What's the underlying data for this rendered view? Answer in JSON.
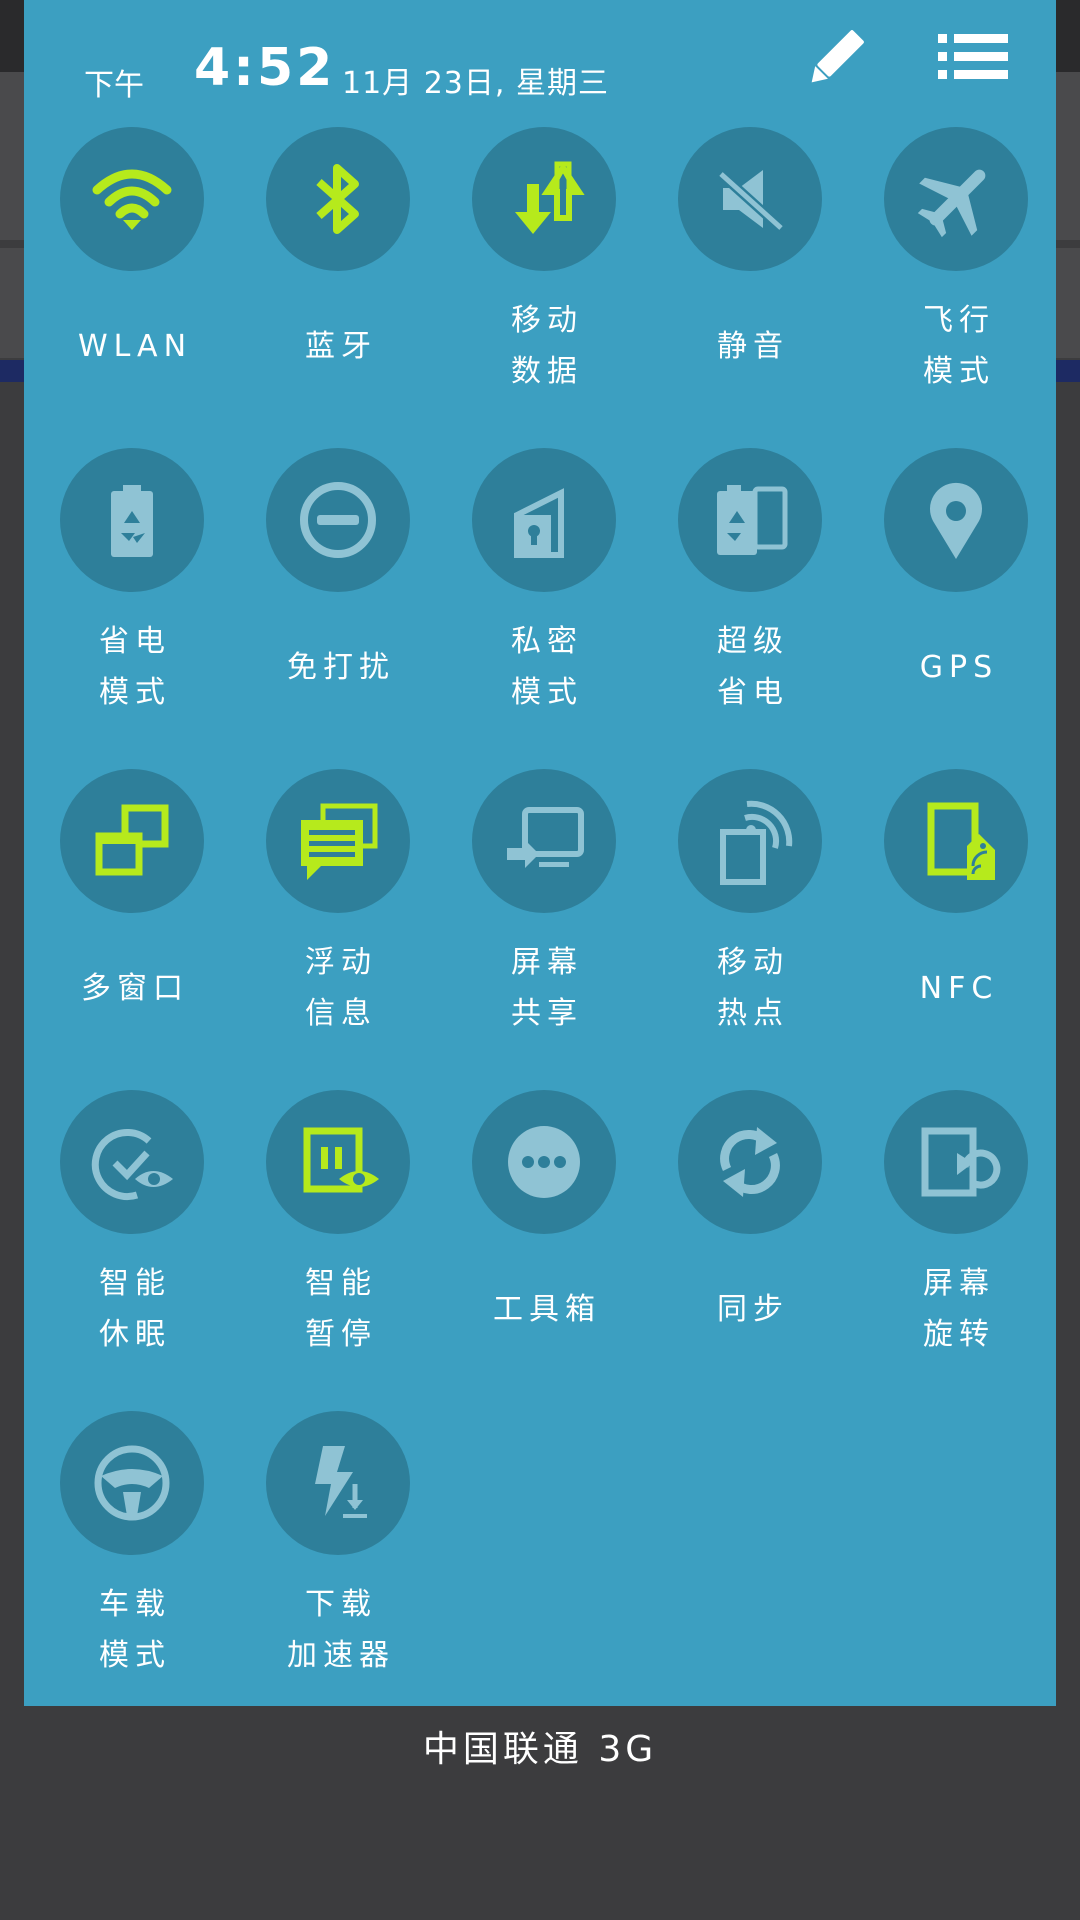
{
  "header": {
    "ampm": "下午",
    "time": "4:52",
    "date": "11月 23日, 星期三",
    "edit_icon": "pencil-icon",
    "list_icon": "list-icon"
  },
  "colors": {
    "active": "#b6ea1c",
    "inactive": "#8fc3d4",
    "panel": "#3c9fc1",
    "circle": "#2e7f9a"
  },
  "tiles": [
    {
      "line1": "WLAN",
      "line2": "",
      "icon": "wifi-icon",
      "active": true
    },
    {
      "line1": "蓝牙",
      "line2": "",
      "icon": "bluetooth-icon",
      "active": true
    },
    {
      "line1": "移动",
      "line2": "数据",
      "icon": "mobile-data-icon",
      "active": true
    },
    {
      "line1": "静音",
      "line2": "",
      "icon": "mute-icon",
      "active": false
    },
    {
      "line1": "飞行",
      "line2": "模式",
      "icon": "airplane-icon",
      "active": false
    },
    {
      "line1": "省电",
      "line2": "模式",
      "icon": "battery-saver-icon",
      "active": false
    },
    {
      "line1": "免打扰",
      "line2": "",
      "icon": "do-not-disturb-icon",
      "active": false
    },
    {
      "line1": "私密",
      "line2": "模式",
      "icon": "private-mode-icon",
      "active": false
    },
    {
      "line1": "超级",
      "line2": "省电",
      "icon": "ultra-power-saving-icon",
      "active": false
    },
    {
      "line1": "GPS",
      "line2": "",
      "icon": "location-pin-icon",
      "active": false
    },
    {
      "line1": "多窗口",
      "line2": "",
      "icon": "multi-window-icon",
      "active": true
    },
    {
      "line1": "浮动",
      "line2": "信息",
      "icon": "floating-message-icon",
      "active": true
    },
    {
      "line1": "屏幕",
      "line2": "共享",
      "icon": "screen-share-icon",
      "active": false
    },
    {
      "line1": "移动",
      "line2": "热点",
      "icon": "hotspot-icon",
      "active": false
    },
    {
      "line1": "NFC",
      "line2": "",
      "icon": "nfc-icon",
      "active": true
    },
    {
      "line1": "智能",
      "line2": "休眠",
      "icon": "smart-stay-icon",
      "active": false
    },
    {
      "line1": "智能",
      "line2": "暂停",
      "icon": "smart-pause-icon",
      "active": true
    },
    {
      "line1": "工具箱",
      "line2": "",
      "icon": "toolbox-icon",
      "active": false
    },
    {
      "line1": "同步",
      "line2": "",
      "icon": "sync-icon",
      "active": false
    },
    {
      "line1": "屏幕",
      "line2": "旋转",
      "icon": "screen-rotation-icon",
      "active": false
    },
    {
      "line1": "车载",
      "line2": "模式",
      "icon": "car-mode-icon",
      "active": false
    },
    {
      "line1": "下载",
      "line2": "加速器",
      "icon": "download-booster-icon",
      "active": false
    }
  ],
  "carrier": "中国联通 3G"
}
